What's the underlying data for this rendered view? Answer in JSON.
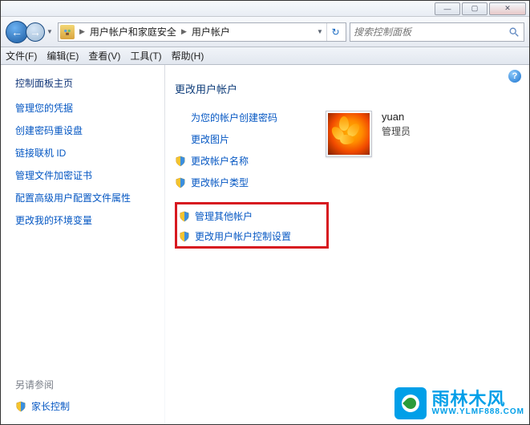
{
  "window": {
    "min_icon": "—",
    "max_icon": "▢",
    "close_icon": "✕"
  },
  "nav": {
    "back_icon": "←",
    "forward_icon": "→",
    "dropdown_icon": "▼",
    "refresh_icon": "↻"
  },
  "breadcrumb": {
    "item1": "用户帐户和家庭安全",
    "item2": "用户帐户",
    "sep": "▶"
  },
  "search": {
    "placeholder": "搜索控制面板"
  },
  "menu": {
    "file": "文件(F)",
    "edit": "编辑(E)",
    "view": "查看(V)",
    "tools": "工具(T)",
    "help": "帮助(H)"
  },
  "sidebar": {
    "home": "控制面板主页",
    "links": [
      "管理您的凭据",
      "创建密码重设盘",
      "链接联机 ID",
      "管理文件加密证书",
      "配置高级用户配置文件属性",
      "更改我的环境变量"
    ],
    "see_also": "另请参阅",
    "parental": "家长控制"
  },
  "main": {
    "heading": "更改用户帐户",
    "actions": {
      "create_password": "为您的帐户创建密码",
      "change_picture": "更改图片",
      "change_name": "更改帐户名称",
      "change_type": "更改帐户类型",
      "manage_other": "管理其他帐户",
      "uac_settings": "更改用户帐户控制设置"
    },
    "user": {
      "name": "yuan",
      "role": "管理员"
    }
  },
  "help": {
    "icon": "?"
  },
  "watermark": {
    "cn": "雨林木风",
    "en": "WWW.YLMF888.COM"
  }
}
